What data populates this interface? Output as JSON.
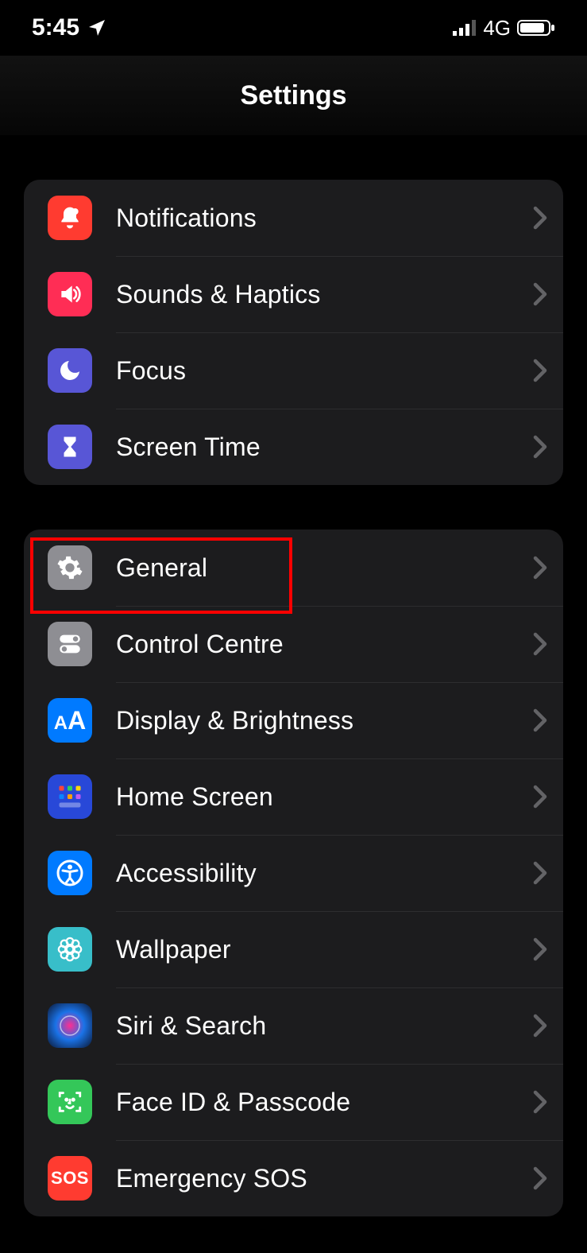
{
  "status": {
    "time": "5:45",
    "network": "4G"
  },
  "header": {
    "title": "Settings"
  },
  "group1": {
    "notifications": "Notifications",
    "sounds": "Sounds & Haptics",
    "focus": "Focus",
    "screentime": "Screen Time"
  },
  "group2": {
    "general": "General",
    "controlcentre": "Control Centre",
    "display": "Display & Brightness",
    "homescreen": "Home Screen",
    "accessibility": "Accessibility",
    "wallpaper": "Wallpaper",
    "siri": "Siri & Search",
    "faceid": "Face ID & Passcode",
    "sos": "Emergency SOS",
    "sos_icon_text": "SOS"
  }
}
